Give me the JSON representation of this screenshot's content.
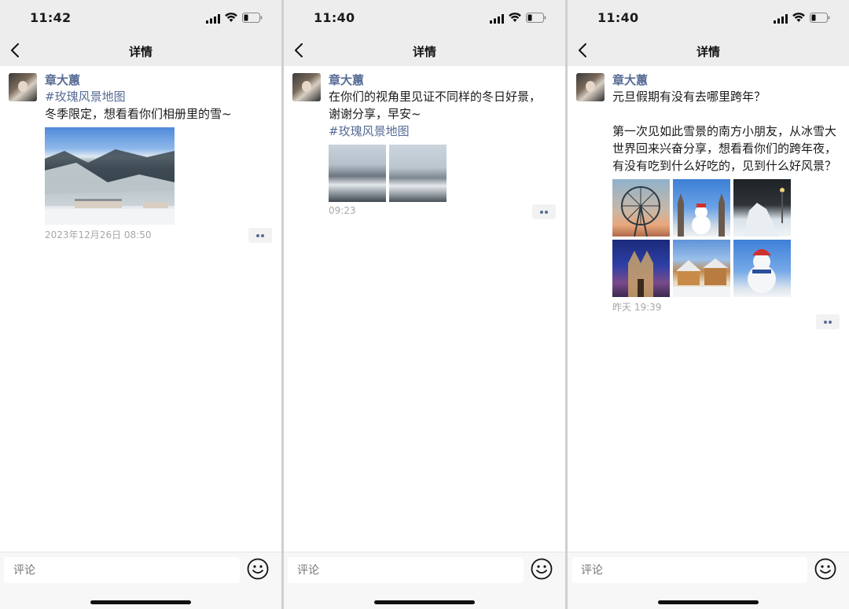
{
  "colors": {
    "link": "#576b95",
    "meta": "#a7a7a7",
    "bar": "#ededed"
  },
  "icons": [
    "chevron-left-icon",
    "cellular-signal-icon",
    "wifi-icon",
    "battery-icon",
    "emoji-icon",
    "more-dots-icon"
  ],
  "screens": [
    {
      "status": {
        "time": "11:42"
      },
      "nav": {
        "title": "详情"
      },
      "post": {
        "username": "章大蕙",
        "tag": "#玫瑰风景地图",
        "text": "冬季限定，想看看你们相册里的雪~",
        "images": [
          "snowy-mountain-village"
        ],
        "timestamp": "2023年12月26日 08:50"
      },
      "footer": {
        "comment_placeholder": "评论"
      }
    },
    {
      "status": {
        "time": "11:40"
      },
      "nav": {
        "title": "详情"
      },
      "post": {
        "username": "章大蕙",
        "text": "在你们的视角里见证不同样的冬日好景，\n谢谢分享，早安~",
        "tag": "#玫瑰风景地图",
        "images": [
          "snowy-trees-river-1",
          "snowy-trees-river-2"
        ],
        "timestamp": "09:23"
      },
      "footer": {
        "comment_placeholder": "评论"
      }
    },
    {
      "status": {
        "time": "11:40"
      },
      "nav": {
        "title": "详情"
      },
      "post": {
        "username": "章大蕙",
        "text": "元旦假期有没有去哪里跨年？\n\n第一次见如此雪景的南方小朋友，从冰雪大世界回来兴奋分享，想看看你们的跨年夜，有没有吃到什么好吃的，见到什么好风景？",
        "images": [
          "ferris-wheel-sunset",
          "snowman-ice-castle",
          "ice-sculpture-night",
          "cathedral-night",
          "snowy-street-houses",
          "giant-snowman"
        ],
        "timestamp": "昨天 19:39"
      },
      "footer": {
        "comment_placeholder": "评论"
      }
    }
  ]
}
